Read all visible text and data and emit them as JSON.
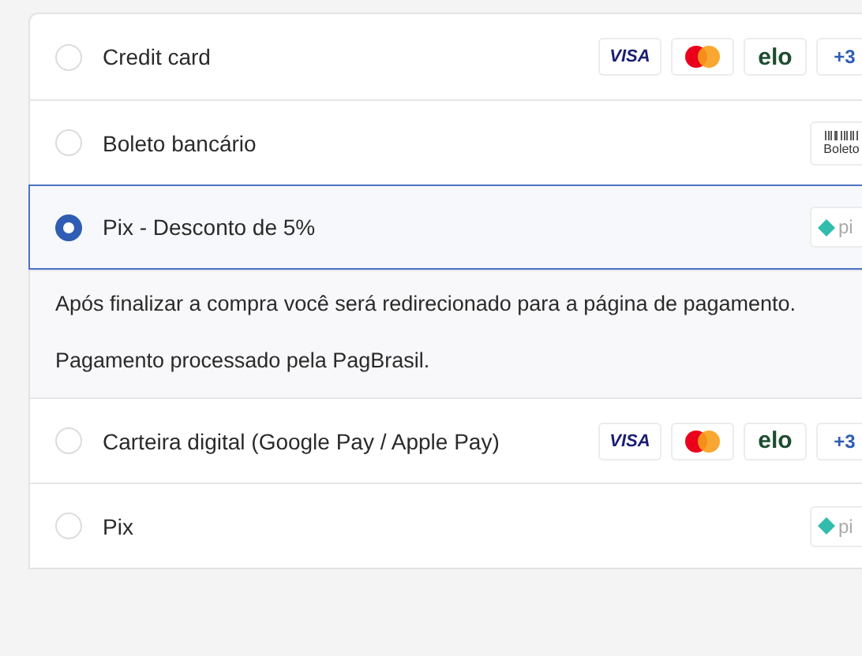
{
  "payment_methods": [
    {
      "label": "Credit card",
      "selected": false,
      "logos": [
        {
          "kind": "visa",
          "text": "VISA"
        },
        {
          "kind": "mastercard"
        },
        {
          "kind": "elo",
          "text": "elo"
        },
        {
          "kind": "more",
          "text": "+3"
        }
      ]
    },
    {
      "label": "Boleto bancário",
      "selected": false,
      "logos": [
        {
          "kind": "boleto",
          "text": "Boleto"
        }
      ]
    },
    {
      "label": "Pix - Desconto de 5%",
      "selected": true,
      "logos": [
        {
          "kind": "pix",
          "text": "pi"
        }
      ],
      "details": [
        "Após finalizar a compra você será redirecionado para a página de pagamento.",
        "Pagamento processado pela PagBrasil."
      ]
    },
    {
      "label": "Carteira digital (Google Pay / Apple Pay)",
      "selected": false,
      "logos": [
        {
          "kind": "visa",
          "text": "VISA"
        },
        {
          "kind": "mastercard"
        },
        {
          "kind": "elo",
          "text": "elo"
        },
        {
          "kind": "more",
          "text": "+3"
        }
      ]
    },
    {
      "label": "Pix",
      "selected": false,
      "logos": [
        {
          "kind": "pix",
          "text": "pi"
        }
      ]
    }
  ]
}
